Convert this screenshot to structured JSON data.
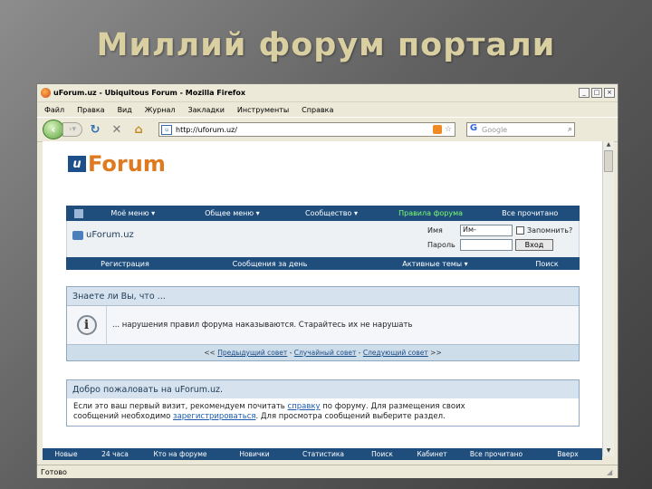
{
  "slide": {
    "title": "Миллий форум портали"
  },
  "browser": {
    "title": "uForum.uz - Ubiquitous Forum - Mozilla Firefox",
    "controls": {
      "min": "_",
      "max": "□",
      "close": "×"
    },
    "menu": [
      "Файл",
      "Правка",
      "Вид",
      "Журнал",
      "Закладки",
      "Инструменты",
      "Справка"
    ],
    "url": "http://uforum.uz/",
    "search_placeholder": "Google",
    "status": "Готово"
  },
  "page": {
    "logo": {
      "mark": "u",
      "text": "Forum"
    },
    "topnav": [
      "Моё меню ▾",
      "Общее меню ▾",
      "Сообщество ▾",
      "Правила форума",
      "Все прочитано"
    ],
    "site_name": "uForum.uz",
    "login": {
      "name_label": "Имя",
      "name_value": "Им-",
      "pass_label": "Пароль",
      "remember_label": "Запомнить?",
      "button": "Вход"
    },
    "subnav": [
      "Регистрация",
      "Сообщения за день",
      "Активные темы ▾",
      "Поиск"
    ],
    "tip": {
      "title": "Знаете ли Вы, что ...",
      "text": "... нарушения правил форума наказываются. Старайтесь их не нарушать",
      "prev": "Предыдущий совет",
      "random": "Случайный совет",
      "next": "Следующий совет",
      "open": "<<",
      "close": ">>",
      "sep": "-"
    },
    "welcome": {
      "title": "Добро пожаловать на uForum.uz.",
      "text1": "Если это ваш первый визит, рекомендуем почитать",
      "link1": "справку",
      "text2": "по форуму. Для размещения своих",
      "text3": "сообщений необходимо",
      "link2": "зарегистрироваться",
      "text4": ". Для просмотра сообщений выберите раздел."
    },
    "bottomnav": [
      "Новые",
      "24 часа",
      "Кто на форуме",
      "Новички",
      "Статистика",
      "Поиск",
      "Кабинет",
      "Все прочитано",
      "Вверх"
    ]
  }
}
